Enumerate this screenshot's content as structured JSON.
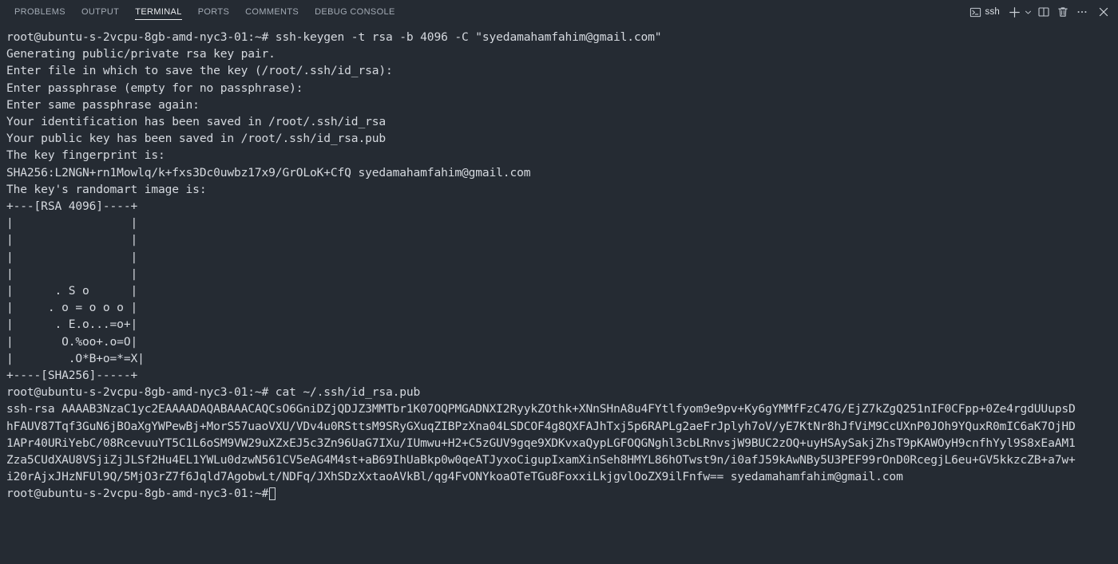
{
  "panel": {
    "tabs": [
      {
        "label": "PROBLEMS",
        "active": false
      },
      {
        "label": "OUTPUT",
        "active": false
      },
      {
        "label": "TERMINAL",
        "active": true
      },
      {
        "label": "PORTS",
        "active": false
      },
      {
        "label": "COMMENTS",
        "active": false
      },
      {
        "label": "DEBUG CONSOLE",
        "active": false
      }
    ],
    "actions": {
      "terminal_kind_label": "ssh",
      "terminal_icon": "terminal-icon",
      "new_terminal_icon": "plus-icon",
      "new_terminal_dropdown_icon": "chevron-down-icon",
      "split_terminal_icon": "split-panel-icon",
      "kill_terminal_icon": "trash-icon",
      "more_actions_icon": "ellipsis-icon",
      "close_panel_icon": "close-icon"
    }
  },
  "colors": {
    "background": "#252b33",
    "foreground": "#d5d9df",
    "tab_active": "#e8eaed",
    "tab_inactive": "#a3abb5"
  },
  "terminal": {
    "prompt": "root@ubuntu-s-2vcpu-8gb-amd-nyc3-01:~#",
    "lines": [
      "root@ubuntu-s-2vcpu-8gb-amd-nyc3-01:~# ssh-keygen -t rsa -b 4096 -C \"syedamahamfahim@gmail.com\"",
      "Generating public/private rsa key pair.",
      "Enter file in which to save the key (/root/.ssh/id_rsa):",
      "Enter passphrase (empty for no passphrase):",
      "Enter same passphrase again:",
      "Your identification has been saved in /root/.ssh/id_rsa",
      "Your public key has been saved in /root/.ssh/id_rsa.pub",
      "The key fingerprint is:",
      "SHA256:L2NGN+rn1Mowlq/k+fxs3Dc0uwbz17x9/GrOLoK+CfQ syedamahamfahim@gmail.com",
      "The key's randomart image is:",
      "+---[RSA 4096]----+",
      "|                 |",
      "|                 |",
      "|                 |",
      "|                 |",
      "|      . S o      |",
      "|     . o = o o o |",
      "|      . E.o...=o+|",
      "|       O.%oo+.o=O|",
      "|        .O*B+o=*=X|",
      "+----[SHA256]-----+",
      "root@ubuntu-s-2vcpu-8gb-amd-nyc3-01:~# cat ~/.ssh/id_rsa.pub",
      "ssh-rsa AAAAB3NzaC1yc2EAAAADAQABAAACAQCsO6GniDZjQDJZ3MMTbr1K07OQPMGADNXI2RyykZOthk+XNnSHnA8u4FYtlfyom9e9pv+Ky6gYMMfFzC47G/EjZ7kZgQ251nIF0CFpp+0Ze4rgdUUupsD",
      "hFAUV87Tqf3GuN6jBOaXgYWPewBj+MorS57uaoVXU/VDv4u0RSttsM9SRyGXuqZIBPzXna04LSDCOF4g8QXFAJhTxj5p6RAPLg2aeFrJplyh7oV/yE7KtNr8hJfViM9CcUXnP0JOh9YQuxR0mIC6aK7OjHD",
      "1APr40URiYebC/08RcevuuYT5C1L6oSM9VW29uXZxEJ5c3Zn96UaG7IXu/IUmwu+H2+C5zGUV9gqe9XDKvxaQypLGFOQGNghl3cbLRnvsjW9BUC2zOQ+uyHSAySakjZhsT9pKAWOyH9cnfhYyl9S8xEaAM1",
      "Zza5CUdXAU8VSjiZjJLSf2Hu4EL1YWLu0dzwN561CV5eAG4M4st+aB69IhUaBkp0w0qeATJyxoCigupIxamXinSeh8HMYL86hOTwst9n/i0afJ59kAwNBy5U3PEF99rOnD0RcegjL6eu+GV5kkzcZB+a7w+",
      "i20rAjxJHzNFUl9Q/5MjO3rZ7f6Jqld7AgobwLt/NDFq/JXhSDzXxtaoAVkBl/qg4FvONYkoaOTeTGu8FoxxiLkjgvlOoZX9ilFnfw== syedamahamfahim@gmail.com",
      "root@ubuntu-s-2vcpu-8gb-amd-nyc3-01:~#"
    ],
    "cursor_visible": true
  }
}
